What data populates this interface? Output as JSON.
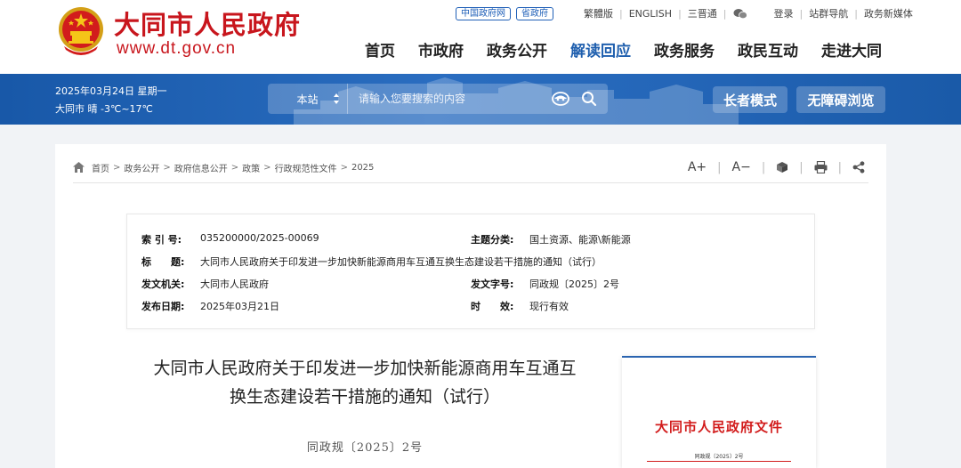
{
  "header": {
    "site_title": "大同市人民政府",
    "site_domain": "www.dt.gov.cn",
    "tag_links": [
      "中国政府网",
      "省政府"
    ],
    "top_links": [
      "繁體版",
      "ENGLISH",
      "三晋通"
    ],
    "account_links": [
      "登录",
      "站群导航",
      "政务新媒体"
    ],
    "nav": [
      "首页",
      "市政府",
      "政务公开",
      "解读回应",
      "政务服务",
      "政民互动",
      "走进大同"
    ],
    "nav_active": "解读回应"
  },
  "banner": {
    "date": "2025年03月24日 星期一",
    "weather": "大同市 晴 -3℃~17℃",
    "search_scope": "本站",
    "search_placeholder": "请输入您要搜索的内容",
    "elder_mode": "长者模式",
    "accessible": "无障碍浏览"
  },
  "breadcrumb": [
    "首页",
    "政务公开",
    "政府信息公开",
    "政策",
    "行政规范性文件",
    "2025"
  ],
  "tools": {
    "font_up": "A+",
    "font_down": "A−"
  },
  "meta": {
    "index_label": "索 引 号:",
    "index_value": "035200000/2025-00069",
    "topic_label": "主题分类:",
    "topic_value": "国土资源、能源\\新能源",
    "title_label": "标　　题:",
    "title_value": "大同市人民政府关于印发进一步加快新能源商用车互通互换生态建设若干措施的通知（试行）",
    "issuer_label": "发文机关:",
    "issuer_value": "大同市人民政府",
    "docno_label": "发文字号:",
    "docno_value": "同政规〔2025〕2号",
    "date_label": "发布日期:",
    "date_value": "2025年03月21日",
    "validity_label": "时　　效:",
    "validity_value": "现行有效"
  },
  "document": {
    "title_line1": "大同市人民政府关于印发进一步加快新能源商用车互通互",
    "title_line2": "换生态建设若干措施的通知（试行）",
    "doc_number": "同政规〔2025〕2号",
    "thumb_title": "大同市人民政府文件",
    "thumb_no": "同政规〔2025〕2号"
  },
  "colors": {
    "brand_red": "#c8161d",
    "banner_blue": "#1f60b0",
    "nav_active": "#1f5fae"
  }
}
